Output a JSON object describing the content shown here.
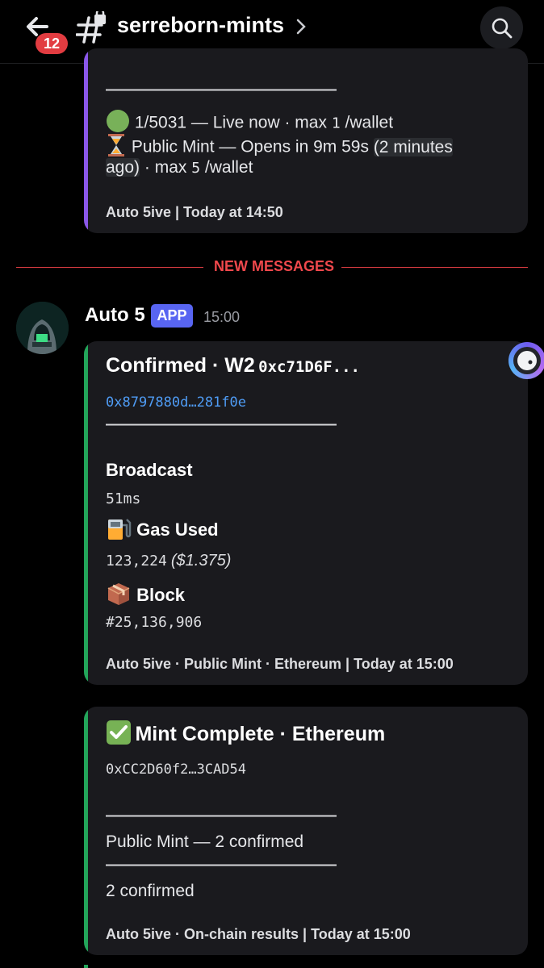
{
  "header": {
    "badge_count": "12",
    "channel_name": "serreborn-mints"
  },
  "prev_embed": {
    "divider": "———————————————",
    "line1_count": "1/5031",
    "line1_rest": "— Live now · max",
    "line1_max": "1",
    "line1_unit": "/wallet",
    "line2_a": "Public Mint — Opens in  9m 59s",
    "line2_rel": "(2 minutes",
    "line3_rel": "ago)",
    "line3_rest": "· max",
    "line3_max": "5",
    "line3_unit": "/wallet",
    "footer": "Auto 5ive | Today at 14:50"
  },
  "new_messages_label": "NEW MESSAGES",
  "message": {
    "author": "Auto 5",
    "badge": "APP",
    "time": "15:00"
  },
  "embed1": {
    "title": "Confirmed · W2",
    "title_addr": "0xc71D6F...",
    "tx_link": "0x8797880d…281f0e",
    "divider": "———————————————",
    "fields": [
      {
        "name": "Broadcast",
        "value": "51ms"
      },
      {
        "name": "Gas Used",
        "value": "123,224",
        "value_extra": "($1.375)"
      },
      {
        "name": "Block",
        "value": "#25,136,906"
      }
    ],
    "footer": "Auto 5ive · Public Mint · Ethereum | Today at 15:00",
    "accent": "#23a55a"
  },
  "embed2": {
    "title": "Mint Complete · Ethereum",
    "address": "0xCC2D60f2…3CAD54",
    "divider1": "———————————————",
    "summary": "Public Mint — 2 confirmed",
    "divider2": "———————————————",
    "result": "2 confirmed",
    "footer": "Auto 5ive · On-chain results | Today at 15:00",
    "accent": "#23a55a"
  },
  "colors": {
    "prev_accent": "#8a57e8",
    "link": "#4f9cf5",
    "new_messages": "#f0484c"
  }
}
